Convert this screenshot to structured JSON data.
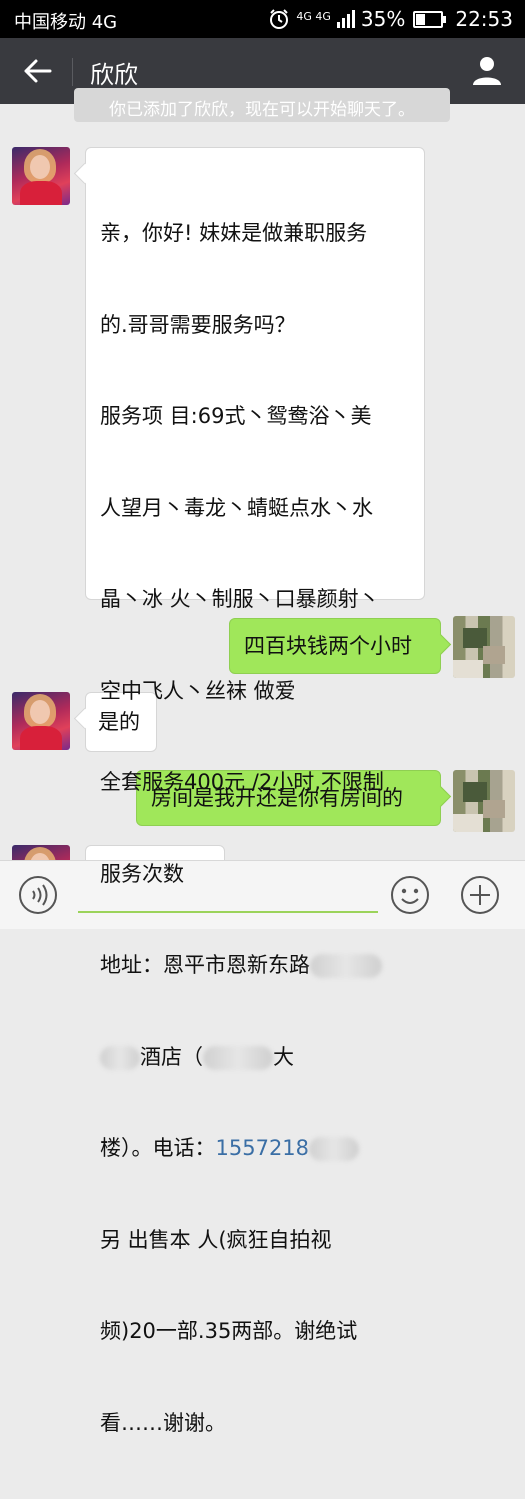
{
  "status_bar": {
    "carrier": "中国移动 4G",
    "network": "4G 4G",
    "battery": "35%",
    "time": "22:53"
  },
  "header": {
    "title": "欣欣"
  },
  "system_message": "你已添加了欣欣，现在可以开始聊天了。",
  "messages": [
    {
      "side": "left",
      "lines": [
        "亲，你好! 妹妹是做兼职服务",
        "的.哥哥需要服务吗？",
        "服务项 目:69式丶鸳鸯浴丶美",
        "人望月丶毒龙丶蜻蜓点水丶水",
        "晶丶冰 火丶制服丶口暴颜射丶",
        "空中飞人丶丝袜 做爱",
        "全套服务400元 /2小时,不限制",
        "服务次数"
      ],
      "address_line": "地址：恩平市恩新东路",
      "hotel_part": "酒店（",
      "building_part": "大",
      "tower_part": "楼）。电话：",
      "phone": "1557218",
      "tail_lines": [
        "另 出售本 人(疯狂自拍视",
        "频)20一部.35两部。谢绝试",
        "看……谢谢。"
      ]
    },
    {
      "side": "right",
      "text": "四百块钱两个小时"
    },
    {
      "side": "left",
      "text": "是的"
    },
    {
      "side": "right",
      "text": "房间是我开还是你有房间的"
    }
  ],
  "colors": {
    "header_bg": "#393a3f",
    "chat_bg": "#ebebeb",
    "sent_bubble": "#a0e75a",
    "received_bubble": "#ffffff"
  },
  "icons": {
    "back": "arrow-left-icon",
    "profile": "person-icon",
    "voice": "voice-icon",
    "emoji": "smiley-icon",
    "more": "plus-icon"
  }
}
